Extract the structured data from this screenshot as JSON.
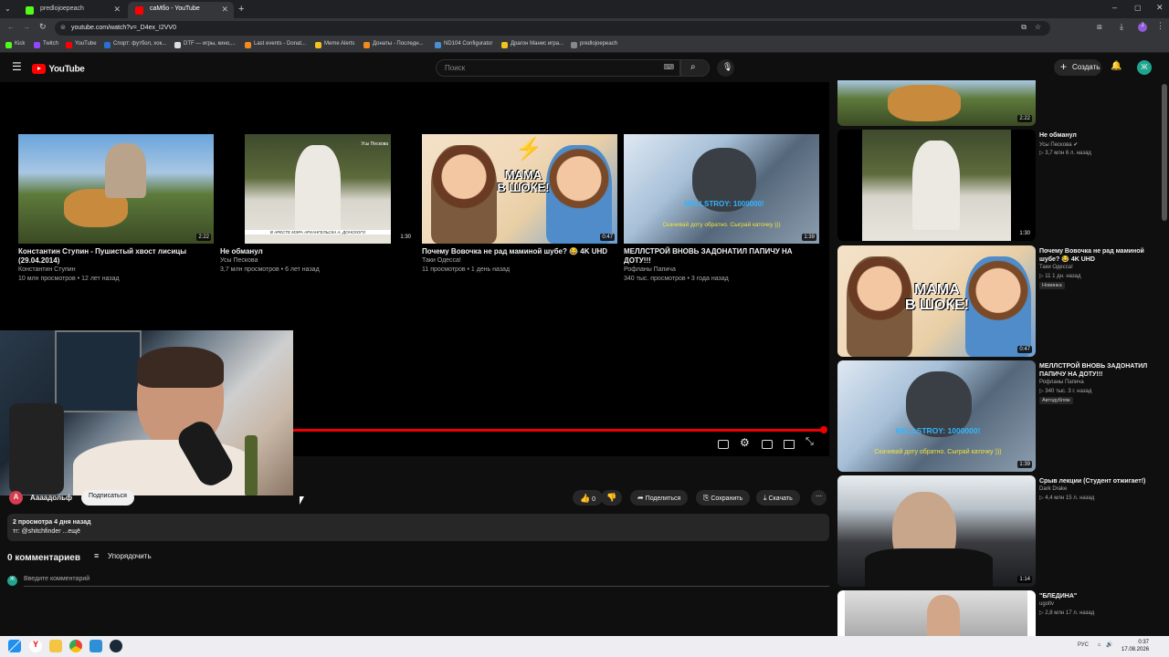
{
  "browser": {
    "tabs": [
      {
        "label": "predlojoepeach",
        "active": false
      },
      {
        "label": "caMбo - YouTube",
        "active": true
      }
    ],
    "url": "youtube.com/watch?v=_D4ex_I2VV0",
    "bookmarks": [
      "Kick",
      "Twitch",
      "YouTube",
      "Спорт: футбол, хок...",
      "DTF — игры, кино,...",
      "Last events - Donat...",
      "Meme Alerts",
      "Донаты - Последн...",
      "ND104 Configurator",
      "Драгон Манис игра...",
      "predlojoepeach"
    ]
  },
  "masthead": {
    "logo": "YouTube",
    "search_placeholder": "Поиск",
    "create_label": "Создать",
    "avatar_letter": "Ж"
  },
  "endscreen": [
    {
      "title": "Константин Ступин - Пушистый хвост лисицы (29.04.2014)",
      "channel": "Константин Ступин",
      "meta": "10 млн просмотров • 12 лет назад",
      "duration": "2:22"
    },
    {
      "title": "Не обманул",
      "channel": "Усы Пескова",
      "meta": "3,7 млн просмотров • 6 лет назад",
      "duration": "1:30"
    },
    {
      "title": "Почему Вовочка не рад маминой шубе? 😂 4K UHD",
      "channel": "Таки Одесса!",
      "meta": "11 просмотров • 1 день назад",
      "duration": "0:47"
    },
    {
      "title": "МЕЛЛСТРОЙ ВНОВЬ ЗАДОНАТИЛ ПАПИЧУ НА ДОТУ!!!",
      "channel": "Рофланы Папича",
      "meta": "340 тыс. просмотров • 3 года назад",
      "duration": "1:39"
    }
  ],
  "thumb_text": {
    "mama": "МАМА\nВ ШОКЕ!",
    "mell_top": "MELLSTROY: 1000000!",
    "mell_bottom": "Скачивай доту обратно. Сыграй каточку )))",
    "putin_caption": "В АРЕСТЕ МЭРА АРХАНГЕЛЬСКА А. ДОНСКОГО",
    "putin_corner": "Усы Пескова"
  },
  "video": {
    "channel_letter": "A",
    "channel_name": "Аааадольф",
    "subscribe_label": "Подписаться",
    "likes": "0",
    "share_label": "Поделиться",
    "save_label": "Сохранить",
    "download_label": "Скачать",
    "views_date": "2 просмотра  4 дня назад",
    "description": "тг: @shitchfinder ...ещё",
    "progress": 1.0
  },
  "comments": {
    "count_label": "0 комментариев",
    "sort_label": "Упорядочить",
    "input_placeholder": "Введите комментарий",
    "avatar_letter": "Ж"
  },
  "sidebar": [
    {
      "title": "",
      "channel": "",
      "stats": "",
      "duration": "2:22",
      "badge": ""
    },
    {
      "title": "Не обманул",
      "channel": "Усы Пескова ✔",
      "stats": "▷ 3,7 млн  6 л. назад",
      "duration": "1:30",
      "badge": ""
    },
    {
      "title": "Почему Вовочка не рад маминой шубе? 😂 4K UHD",
      "channel": "Таки Одесса!",
      "stats": "▷ 11  1 дн. назад",
      "duration": "0:47",
      "badge": "Новинка"
    },
    {
      "title": "МЕЛЛСТРОЙ ВНОВЬ ЗАДОНАТИЛ ПАПИЧУ НА ДОТУ!!!",
      "channel": "Рофланы Папича",
      "stats": "▷ 340 тыс.  3 г. назад",
      "duration": "1:39",
      "badge": "Автодубляж"
    },
    {
      "title": "Срыв лекции (Студент отжигает!)",
      "channel": "Dark Drake",
      "stats": "▷ 4,4 млн  15 л. назад",
      "duration": "1:14",
      "badge": ""
    },
    {
      "title": "\"БЛЕДИНА\"",
      "channel": "ugoltv",
      "stats": "▷ 2,8 млн  17 л. назад",
      "duration": "",
      "badge": ""
    }
  ],
  "taskbar": {
    "lang": "РУС",
    "time": "0:37",
    "date": "17.08.2026"
  }
}
